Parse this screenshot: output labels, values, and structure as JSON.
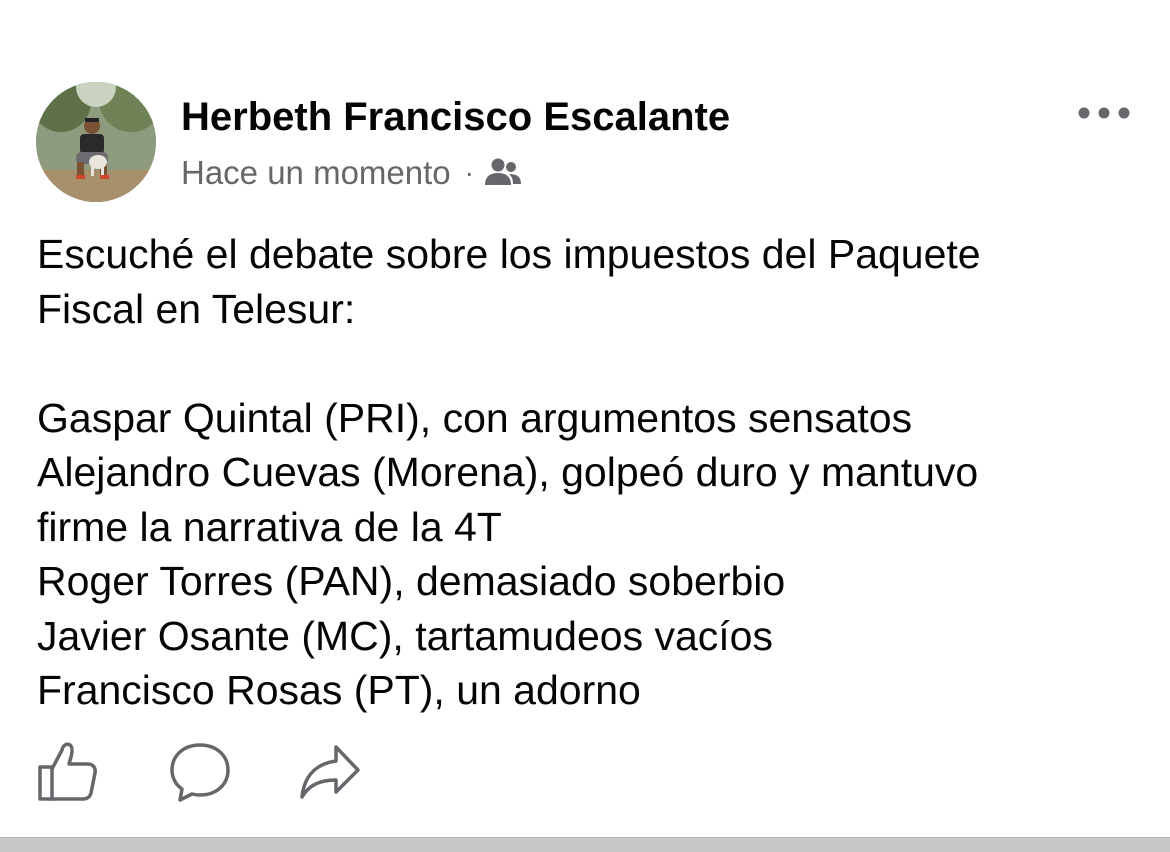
{
  "post": {
    "author": "Herbeth Francisco Escalante",
    "timestamp": "Hace un momento",
    "separator": "·",
    "audience_icon": "friends-icon",
    "text": "Escuché el debate sobre los impuestos del Paquete\nFiscal en Telesur:\n\nGaspar Quintal (PRI), con argumentos sensatos\nAlejandro Cuevas (Morena), golpeó duro y mantuvo\nfirme la narrativa de la 4T\nRoger Torres (PAN), demasiado soberbio\nJavier Osante (MC), tartamudeos vacíos\nFrancisco Rosas (PT), un adorno"
  },
  "actions": {
    "like_icon": "thumbs-up-icon",
    "comment_icon": "comment-bubble-icon",
    "share_icon": "share-arrow-icon",
    "more_icon": "more-dots-icon"
  },
  "colors": {
    "text": "#050505",
    "secondary_text": "#65676b",
    "icon": "#65676b",
    "divider": "#c6c7c9"
  }
}
